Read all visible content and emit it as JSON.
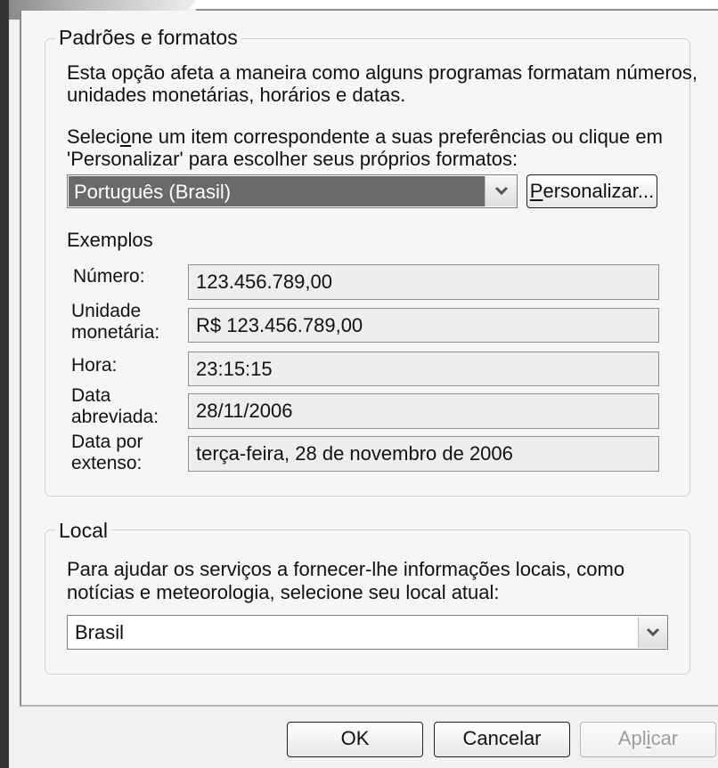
{
  "standards_group": {
    "title": "Padrões e formatos",
    "description_line1": "Esta opção afeta a maneira como alguns programas formatam números,",
    "description_line2": "unidades monetárias, horários e datas.",
    "select_prompt_before": "Seleci",
    "select_prompt_underlined": "o",
    "select_prompt_after": "ne um item correspondente a suas preferências ou clique em",
    "select_prompt_line2": "'Personalizar' para escolher seus próprios formatos:",
    "selected_format": "Português (Brasil)",
    "customize_button_underlined": "P",
    "customize_button_rest": "ersonalizar...",
    "examples_title": "Exemplos",
    "examples": [
      {
        "label_line1": "Número:",
        "label_line2": "",
        "value": "123.456.789,00"
      },
      {
        "label_line1": "Unidade",
        "label_line2": "monetária:",
        "value": "R$ 123.456.789,00"
      },
      {
        "label_line1": "Hora:",
        "label_line2": "",
        "value": "23:15:15"
      },
      {
        "label_line1": "Data",
        "label_line2": "abreviada:",
        "value": "28/11/2006"
      },
      {
        "label_line1": "Data por",
        "label_line2": "extenso:",
        "value": "terça-feira, 28 de novembro de 2006"
      }
    ]
  },
  "location_group": {
    "title": "Local",
    "description_line1_before": "Para a",
    "description_line1_underlined": "j",
    "description_line1_after": "udar os serviços a fornecer-lhe informações locais, como",
    "description_line2": "notícias e meteorologia, selecione seu local atual:",
    "selected_location": "Brasil"
  },
  "buttons": {
    "ok": "OK",
    "cancel": "Cancelar",
    "apply_before": "Apl",
    "apply_underlined": "i",
    "apply_after": "car"
  },
  "icons": {
    "dropdown": "chevron-down-icon"
  },
  "colors": {
    "selection": "#6a6a6a",
    "panel": "#f6f6f4",
    "window": "#f1f1ef"
  }
}
